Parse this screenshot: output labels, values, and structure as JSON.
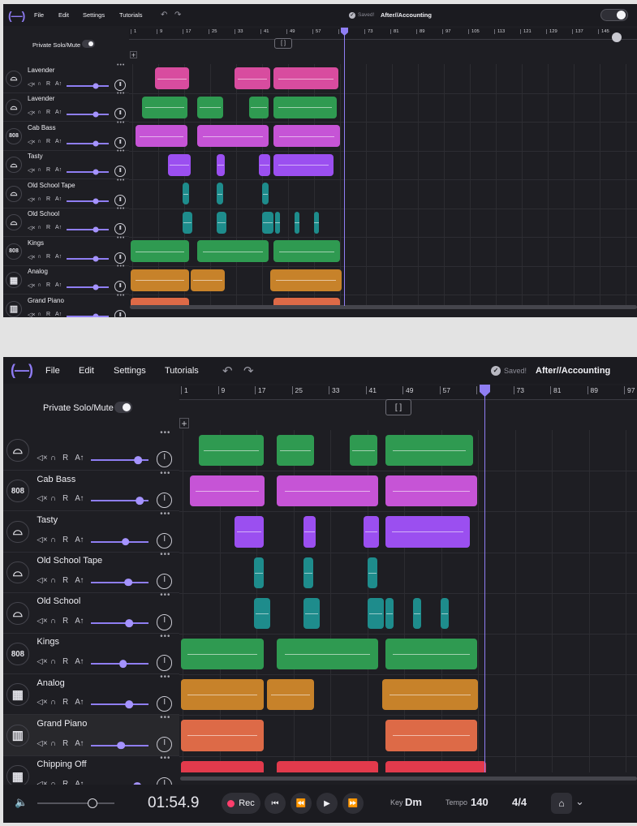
{
  "menu": {
    "file": "File",
    "edit": "Edit",
    "settings": "Settings",
    "tutorials": "Tutorials"
  },
  "status": {
    "saved": "Saved!"
  },
  "project": {
    "name": "After//Accounting"
  },
  "private_solo": "Private Solo/Mute",
  "loop_icon": "[ ]",
  "ruler_top": [
    "1",
    "9",
    "17",
    "25",
    "33",
    "41",
    "49",
    "57",
    "65",
    "73",
    "81",
    "89",
    "97",
    "105",
    "113",
    "121",
    "129",
    "137",
    "145"
  ],
  "ruler_bottom": [
    "1",
    "9",
    "17",
    "25",
    "33",
    "41",
    "49",
    "57",
    "65",
    "73",
    "81",
    "89",
    "97"
  ],
  "track_icons": {
    "drum": "drum-icon",
    "bass": "808",
    "keys": "keyboard-icon",
    "piano": "piano-icon"
  },
  "colors": {
    "accent": "#8f7ef3",
    "pink": "#d84c9f",
    "green": "#2f9a51",
    "magenta": "#c654d6",
    "violet": "#9b4ff0",
    "teal": "#1e8c8c",
    "orange": "#c7822a",
    "coral": "#dd6a47",
    "red": "#e23a4c"
  },
  "tracks_top": [
    {
      "name": "Lavender",
      "icon": "drum"
    },
    {
      "name": "Lavender",
      "icon": "drum"
    },
    {
      "name": "Cab Bass",
      "icon": "bass"
    },
    {
      "name": "Tasty",
      "icon": "drum"
    },
    {
      "name": "Old School Tape",
      "icon": "drum"
    },
    {
      "name": "Old School",
      "icon": "drum"
    },
    {
      "name": "Kings",
      "icon": "bass"
    },
    {
      "name": "Analog",
      "icon": "keys"
    },
    {
      "name": "Grand Piano",
      "icon": "piano"
    }
  ],
  "tracks_bottom": [
    {
      "name": "",
      "icon": "drum",
      "volume": 0.82
    },
    {
      "name": "Cab Bass",
      "icon": "bass",
      "volume": 0.84
    },
    {
      "name": "Tasty",
      "icon": "drum",
      "volume": 0.6
    },
    {
      "name": "Old School Tape",
      "icon": "drum",
      "volume": 0.65
    },
    {
      "name": "Old School",
      "icon": "drum",
      "volume": 0.66
    },
    {
      "name": "Kings",
      "icon": "bass",
      "volume": 0.56
    },
    {
      "name": "Analog",
      "icon": "keys",
      "volume": 0.66
    },
    {
      "name": "Grand Piano",
      "icon": "piano",
      "volume": 0.52
    },
    {
      "name": "Chipping Off",
      "icon": "keys",
      "volume": 0.8
    }
  ],
  "track_controls": {
    "mute": "🔇",
    "headphones": "∩",
    "record": "R",
    "automation": "A↑"
  },
  "transport": {
    "time": "01:54.9",
    "rec": "Rec",
    "key_label": "Key",
    "key": "Dm",
    "tempo_label": "Tempo",
    "tempo": "140",
    "meter": "4/4"
  }
}
